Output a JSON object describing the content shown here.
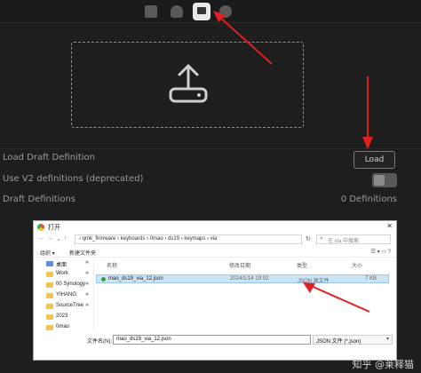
{
  "toolbar": {
    "icons": [
      "keyboard-icon",
      "test-icon",
      "design-icon",
      "settings-icon"
    ],
    "active_icon": "design-icon"
  },
  "dropzone": {
    "icon": "upload-icon"
  },
  "settings": {
    "load_draft_label": "Load Draft Definition",
    "load_button_label": "Load",
    "v2_label": "Use V2 definitions (deprecated)",
    "v2_enabled": false,
    "draft_label": "Draft Definitions",
    "draft_count": "0 Definitions"
  },
  "dialog": {
    "title": "打开",
    "close_glyph": "✕",
    "breadcrumb": "› qmk_firmware › keyboards › 0mao › ds19 › keymaps › via",
    "search_placeholder": "在 via 中搜索",
    "organize_label": "组织 ▾",
    "new_folder_label": "新建文件夹",
    "nav_items": [
      {
        "label": "桌面",
        "icon": "desktop-folder-icon"
      },
      {
        "label": "Work",
        "icon": "folder-icon"
      },
      {
        "label": "00 Synology",
        "icon": "folder-icon"
      },
      {
        "label": "YIHANG",
        "icon": "folder-icon"
      },
      {
        "label": "SourceTree",
        "icon": "folder-icon"
      },
      {
        "label": "2023",
        "icon": "folder-icon"
      },
      {
        "label": "0mao",
        "icon": "folder-icon"
      }
    ],
    "columns": {
      "name": "名称",
      "date": "修改日期",
      "type": "类型",
      "size": "大小"
    },
    "files": [
      {
        "name": "mao_ds19_via_12.json",
        "date": "2024/1/14 19:02",
        "type": "JSON 源文件",
        "size": "7 KB"
      }
    ],
    "filename_label": "文件名(N):",
    "filename_value": "mao_ds19_via_12.json",
    "filetype_value": "JSON 文件 (*.json)"
  },
  "watermark": "知乎 @莱释猫",
  "colors": {
    "background": "#1e1e1e",
    "arrow": "#e02020",
    "selection": "#cce4f7"
  }
}
